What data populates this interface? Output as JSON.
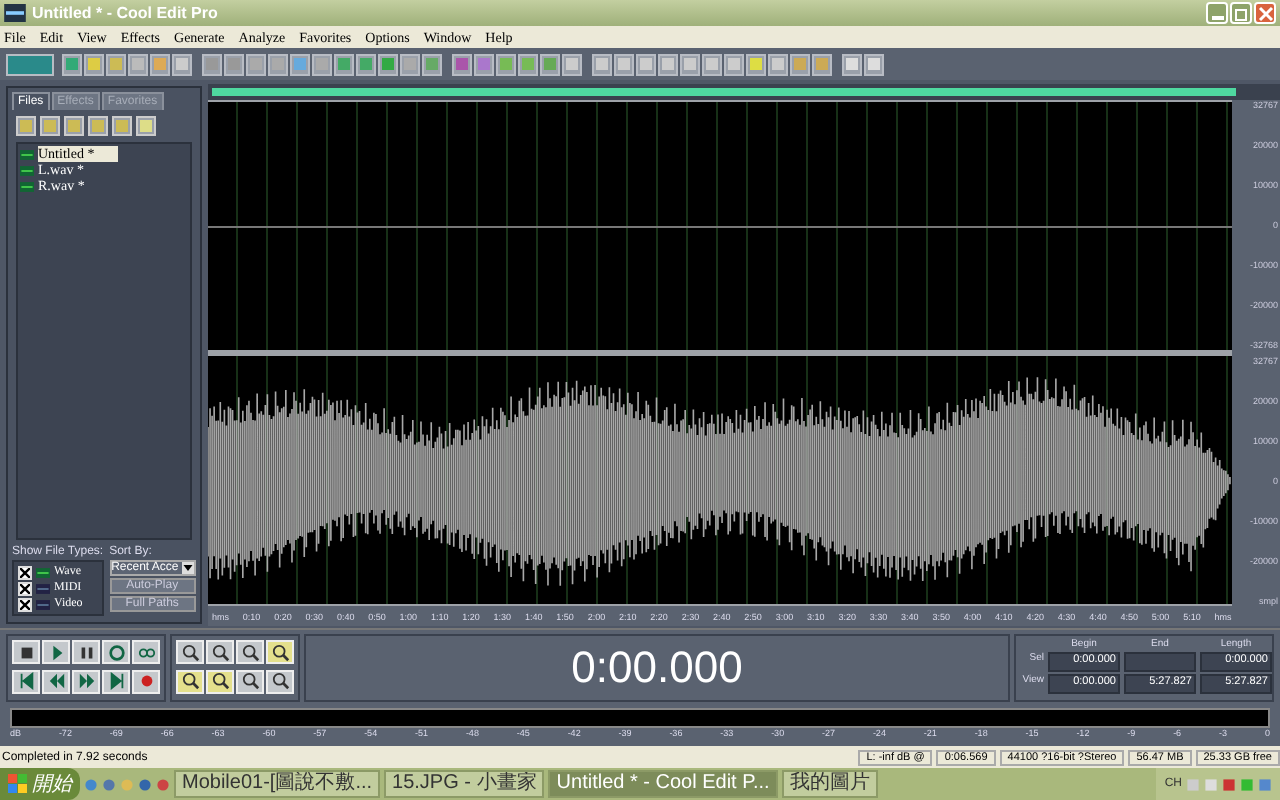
{
  "window": {
    "title": "Untitled * - Cool Edit Pro"
  },
  "menu": [
    "File",
    "Edit",
    "View",
    "Effects",
    "Generate",
    "Analyze",
    "Favorites",
    "Options",
    "Window",
    "Help"
  ],
  "file_panel": {
    "tabs": [
      {
        "label": "Files",
        "selected": true
      },
      {
        "label": "Effects",
        "selected": false
      },
      {
        "label": "Favorites",
        "selected": false
      }
    ],
    "files": [
      {
        "name": "Untitled *",
        "selected": true
      },
      {
        "name": "L.wav *",
        "selected": false
      },
      {
        "name": "R.wav *",
        "selected": false
      }
    ],
    "show_types_label": "Show File Types:",
    "sort_label": "Sort By:",
    "sort_value": "Recent Acce",
    "types": [
      {
        "label": "Wave",
        "checked": true
      },
      {
        "label": "MIDI",
        "checked": true
      },
      {
        "label": "Video",
        "checked": true
      }
    ],
    "buttons": [
      "Auto-Play",
      "Full Paths"
    ]
  },
  "waveform": {
    "top_scale": [
      "32767",
      "20000",
      "10000",
      "0",
      "-10000",
      "-20000",
      "-32768"
    ],
    "bottom_scale": [
      "32767",
      "20000",
      "10000",
      "0",
      "-10000",
      "-20000",
      "smpl"
    ],
    "time_axis": [
      "hms",
      "0:10",
      "0:20",
      "0:30",
      "0:40",
      "0:50",
      "1:00",
      "1:10",
      "1:20",
      "1:30",
      "1:40",
      "1:50",
      "2:00",
      "2:10",
      "2:20",
      "2:30",
      "2:40",
      "2:50",
      "3:00",
      "3:10",
      "3:20",
      "3:30",
      "3:40",
      "3:50",
      "4:00",
      "4:10",
      "4:20",
      "4:30",
      "4:40",
      "4:50",
      "5:00",
      "5:10",
      "hms"
    ]
  },
  "time_display": "0:00.000",
  "selection": {
    "headers": [
      "Begin",
      "End",
      "Length"
    ],
    "rows": [
      {
        "label": "Sel",
        "begin": "0:00.000",
        "length": "0:00.000"
      },
      {
        "label": "View",
        "begin": "0:00.000",
        "end": "5:27.827",
        "length": "5:27.827"
      }
    ]
  },
  "meter_scale": [
    "dB",
    "-72",
    "-69",
    "-66",
    "-63",
    "-60",
    "-57",
    "-54",
    "-51",
    "-48",
    "-45",
    "-42",
    "-39",
    "-36",
    "-33",
    "-30",
    "-27",
    "-24",
    "-21",
    "-18",
    "-15",
    "-12",
    "-9",
    "-6",
    "-3",
    "0"
  ],
  "status_bar": {
    "message": "Completed in 7.92 seconds",
    "fields": [
      "L: -inf dB @",
      "0:06.569",
      "44100 ?16-bit ?Stereo",
      "56.47 MB",
      "25.33 GB free"
    ]
  },
  "taskbar": {
    "start": "開始",
    "tasks": [
      {
        "label": "Mobile01-[圖說不敷...",
        "selected": false
      },
      {
        "label": "15.JPG - 小畫家",
        "selected": false
      },
      {
        "label": "Untitled * - Cool Edit P...",
        "selected": true
      },
      {
        "label": "我的圖片",
        "selected": false
      }
    ],
    "tray": "CH"
  }
}
